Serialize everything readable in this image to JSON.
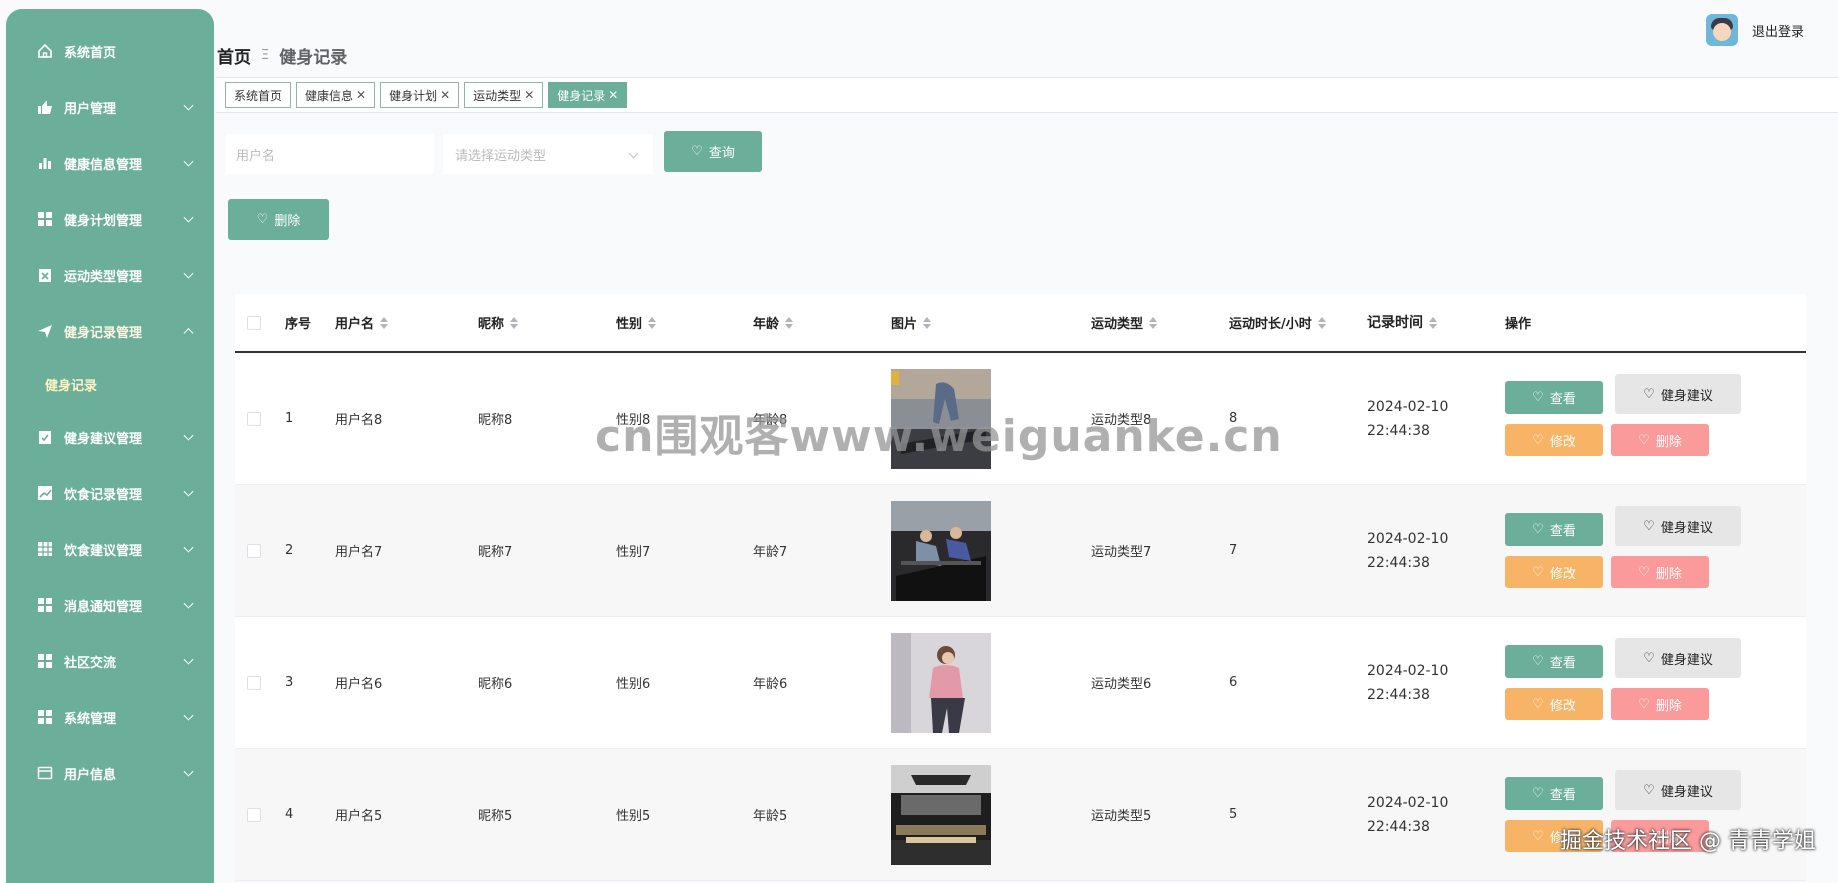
{
  "sidebar": {
    "items": [
      {
        "label": "系统首页",
        "icon": "home-icon"
      },
      {
        "label": "用户管理",
        "icon": "user-icon"
      },
      {
        "label": "健康信息管理",
        "icon": "chart-icon"
      },
      {
        "label": "健身计划管理",
        "icon": "grid-icon"
      },
      {
        "label": "运动类型管理",
        "icon": "clipboard-icon"
      },
      {
        "label": "健身记录管理",
        "icon": "send-icon"
      },
      {
        "label": "健身建议管理",
        "icon": "clipboard-check-icon"
      },
      {
        "label": "饮食记录管理",
        "icon": "trend-icon"
      },
      {
        "label": "饮食建议管理",
        "icon": "table-icon"
      },
      {
        "label": "消息通知管理",
        "icon": "grid-icon"
      },
      {
        "label": "社区交流",
        "icon": "grid-icon"
      },
      {
        "label": "系统管理",
        "icon": "grid-icon"
      },
      {
        "label": "用户信息",
        "icon": "card-icon"
      }
    ],
    "sub_item": "健身记录"
  },
  "header": {
    "home": "首页",
    "separator": "Ξ",
    "current": "健身记录",
    "logout": "退出登录"
  },
  "tags": [
    {
      "label": "系统首页",
      "closable": false,
      "active": false
    },
    {
      "label": "健康信息",
      "closable": true,
      "active": false
    },
    {
      "label": "健身计划",
      "closable": true,
      "active": false
    },
    {
      "label": "运动类型",
      "closable": true,
      "active": false
    },
    {
      "label": "健身记录",
      "closable": true,
      "active": true
    }
  ],
  "search": {
    "username_placeholder": "用户名",
    "type_placeholder": "请选择运动类型",
    "query_label": "查询",
    "delete_label": "删除"
  },
  "table": {
    "headers": {
      "index": "序号",
      "username": "用户名",
      "nickname": "昵称",
      "sex": "性别",
      "age": "年龄",
      "image": "图片",
      "type": "运动类型",
      "duration": "运动时长/小时",
      "time": "记录时间",
      "ops": "操作"
    },
    "rows": [
      {
        "index": "1",
        "username": "用户名8",
        "nickname": "昵称8",
        "sex": "性别8",
        "age": "年龄8",
        "type": "运动类型8",
        "duration": "8",
        "time": "2024-02-10 22:44:38"
      },
      {
        "index": "2",
        "username": "用户名7",
        "nickname": "昵称7",
        "sex": "性别7",
        "age": "年龄7",
        "type": "运动类型7",
        "duration": "7",
        "time": "2024-02-10 22:44:38"
      },
      {
        "index": "3",
        "username": "用户名6",
        "nickname": "昵称6",
        "sex": "性别6",
        "age": "年龄6",
        "type": "运动类型6",
        "duration": "6",
        "time": "2024-02-10 22:44:38"
      },
      {
        "index": "4",
        "username": "用户名5",
        "nickname": "昵称5",
        "sex": "性别5",
        "age": "年龄5",
        "type": "运动类型5",
        "duration": "5",
        "time": "2024-02-10 22:44:38"
      }
    ],
    "actions": {
      "view": "查看",
      "advice": "健身建议",
      "edit": "修改",
      "delete": "删除"
    }
  },
  "watermark": "cn围观客www.weiguanke.cn",
  "footer_mark": "掘金技术社区 @ 青青学姐",
  "colors": {
    "primary": "#6baf9b",
    "edit": "#f7b466",
    "delete": "#fb9a9a",
    "advice": "#e6e6e6"
  }
}
